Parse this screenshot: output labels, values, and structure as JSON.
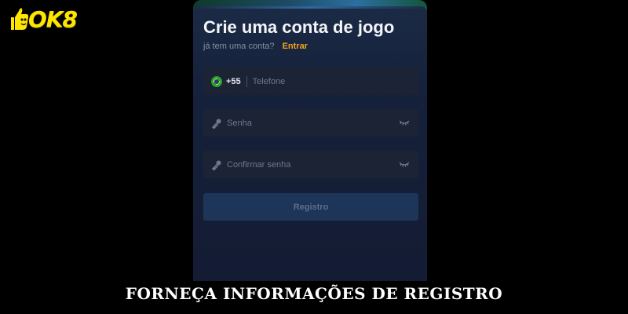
{
  "logo": {
    "brand": "OK8",
    "icon": "thumbs-up-icon"
  },
  "form": {
    "title": "Crie uma conta de jogo",
    "have_account": "já tem uma conta?",
    "login_link": "Entrar",
    "phone": {
      "country_code": "+55",
      "placeholder": "Telefone",
      "flag_icon": "brazil-flag-icon"
    },
    "password": {
      "placeholder": "Senha",
      "icon": "key-icon",
      "toggle_icon": "eye-closed-icon"
    },
    "confirm_password": {
      "placeholder": "Confirmar senha",
      "icon": "key-icon",
      "toggle_icon": "eye-closed-icon"
    },
    "submit_label": "Registro"
  },
  "caption": "FORNEÇA INFORMAÇÕES DE REGISTRO",
  "colors": {
    "brand_yellow": "#ffe600",
    "link_orange": "#f2a51c",
    "card_bg": "#15203a",
    "button_bg": "#1d3558"
  }
}
